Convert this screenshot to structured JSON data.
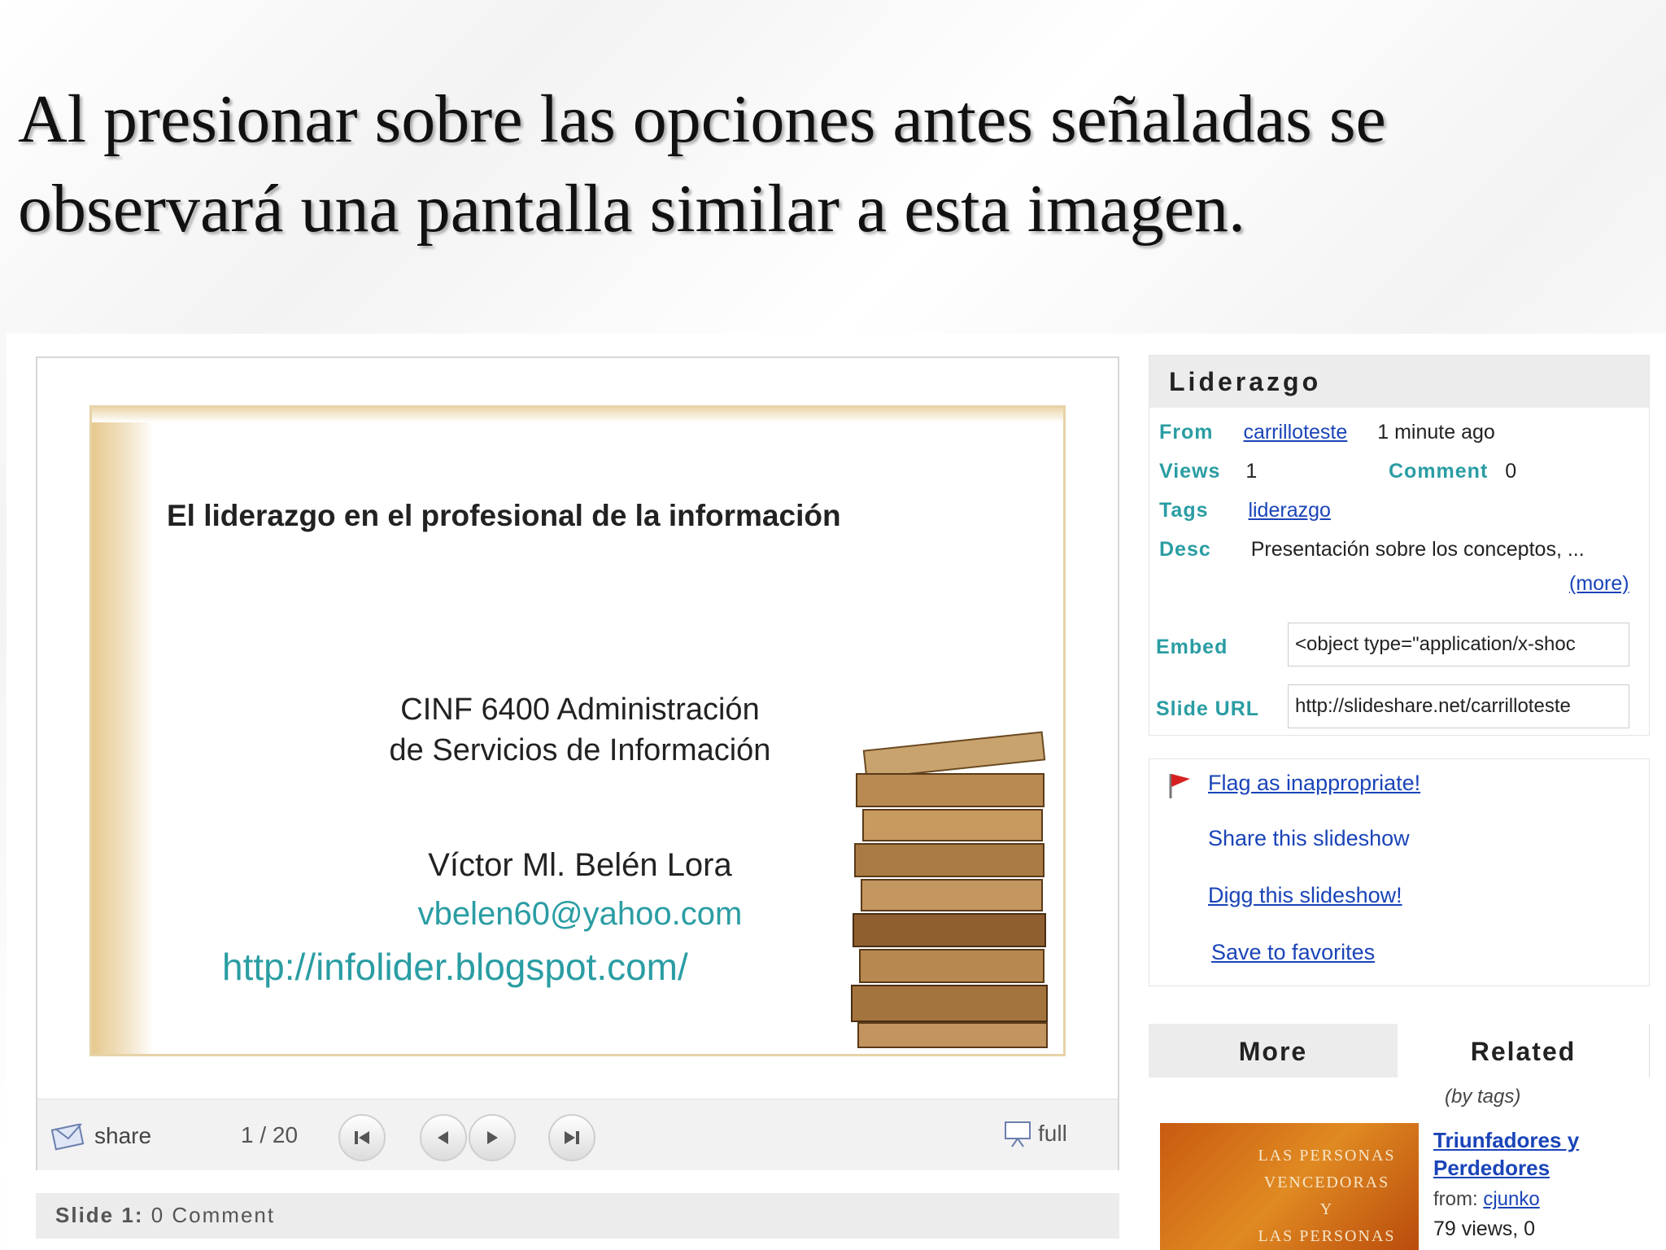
{
  "heading": {
    "line1": "Al presionar sobre las opciones antes señaladas se",
    "line2": "observará una pantalla similar a esta imagen."
  },
  "slide": {
    "title": "El liderazgo en el profesional de la información",
    "course_line1": "CINF 6400 Administración",
    "course_line2": "de Servicios de Información",
    "author": "Víctor Ml. Belén Lora",
    "email": "vbelen60@yahoo.com",
    "url": "http://infolider.blogspot.com/"
  },
  "controls": {
    "share_label": "share",
    "counter": "1 / 20",
    "full_label": "full"
  },
  "comment_bar": {
    "slide_label": "Slide 1:",
    "comments": "0 Comment"
  },
  "info": {
    "title": "Liderazgo",
    "from_label": "From",
    "from_user": "carrilloteste",
    "time_ago": "1 minute ago",
    "views_label": "Views",
    "views_value": "1",
    "comment_label": "Comment",
    "comment_value": "0",
    "tags_label": "Tags",
    "tags_value": "liderazgo",
    "desc_label": "Desc",
    "desc_value": "Presentación sobre los conceptos, ...",
    "more_link": "(more)",
    "embed_label": "Embed",
    "embed_value": "<object type=\"application/x-shoc",
    "slide_url_label": "Slide URL",
    "slide_url_value": "http://slideshare.net/carrilloteste"
  },
  "actions": {
    "flag": "Flag as inappropriate!",
    "share": "Share this slideshow",
    "digg": "Digg this slideshow!",
    "favorites": "Save to favorites"
  },
  "tabs": {
    "more": "More",
    "related": "Related",
    "related_sub": "(by tags)"
  },
  "related_item": {
    "thumb_text": [
      "LAS PERSONAS",
      "VENCEDORAS",
      "Y",
      "LAS PERSONAS"
    ],
    "title": "Triunfadores y Perdedores",
    "from_label": "from:",
    "from_user": "cjunko",
    "views": "79 views, 0"
  },
  "colors": {
    "label_teal": "#2a9da3",
    "link_blue": "#1a44b8",
    "thumb_orange": "#d9721a"
  }
}
